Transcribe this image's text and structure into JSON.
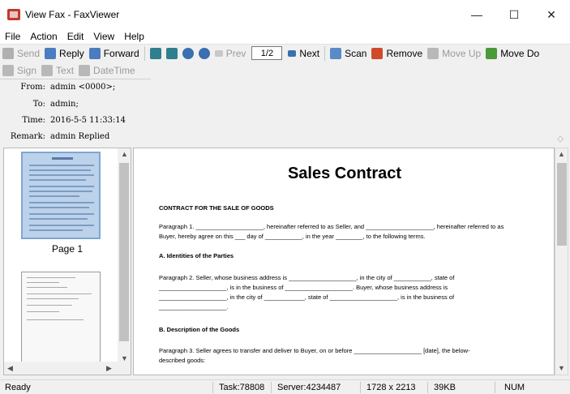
{
  "window": {
    "title": "View Fax - FaxViewer",
    "minimize_glyph": "—",
    "maximize_glyph": "☐",
    "close_glyph": "✕"
  },
  "menu": [
    "File",
    "Action",
    "Edit",
    "View",
    "Help"
  ],
  "toolbar": {
    "send": "Send",
    "reply": "Reply",
    "forward": "Forward",
    "prev": "Prev",
    "page": "1/2",
    "next": "Next",
    "scan": "Scan",
    "remove": "Remove",
    "move_up": "Move Up",
    "move_down": "Move Do",
    "sign": "Sign",
    "text": "Text",
    "datetime": "DateTime"
  },
  "info": {
    "from_label": "From:",
    "from": "admin <0000>;",
    "to_label": "To:",
    "to": "admin;",
    "time_label": "Time:",
    "time": "2016-5-5 11:33:14",
    "remark_label": "Remark:",
    "remark": "admin Replied"
  },
  "thumbnails": {
    "page1_label": "Page 1"
  },
  "document": {
    "title": "Sales Contract",
    "heading1": "CONTRACT FOR THE SALE OF GOODS",
    "para1_line1": "Paragraph 1. ____________________, hereinafter referred to as Seller, and ____________________, hereinafter referred to as",
    "para1_line2": "Buyer, hereby agree on this ___ day of ___________, in the year ________, to the following terms.",
    "heading2": "A. Identities of the Parties",
    "para2_line1": "Paragraph 2. Seller, whose business address is ____________________, in the city of ___________, state of",
    "para2_line2": "____________________, is in the business of ____________________. Buyer, whose business address is",
    "para2_line3": "____________________, in the city of ____________, state of ____________________, is in the business of",
    "para2_line4": "____________________.",
    "heading3": "B. Description of the Goods",
    "para3_line1": "Paragraph 3. Seller agrees to transfer and deliver to Buyer, on or before ____________________ [date], the below-",
    "para3_line2": "described goods:"
  },
  "status": {
    "ready": "Ready",
    "task": "Task:78808",
    "server": "Server:4234487",
    "dims": "1728 x 2213",
    "size": "39KB",
    "num": "NUM"
  },
  "icons": [
    "app-icon",
    "send-icon",
    "reply-icon",
    "forward-icon",
    "rotate-left-icon",
    "rotate-right-icon",
    "zoom-in-icon",
    "zoom-out-icon",
    "prev-icon",
    "next-icon",
    "scan-icon",
    "remove-icon",
    "move-up-icon",
    "move-down-icon",
    "sign-icon",
    "text-icon",
    "datetime-icon"
  ]
}
